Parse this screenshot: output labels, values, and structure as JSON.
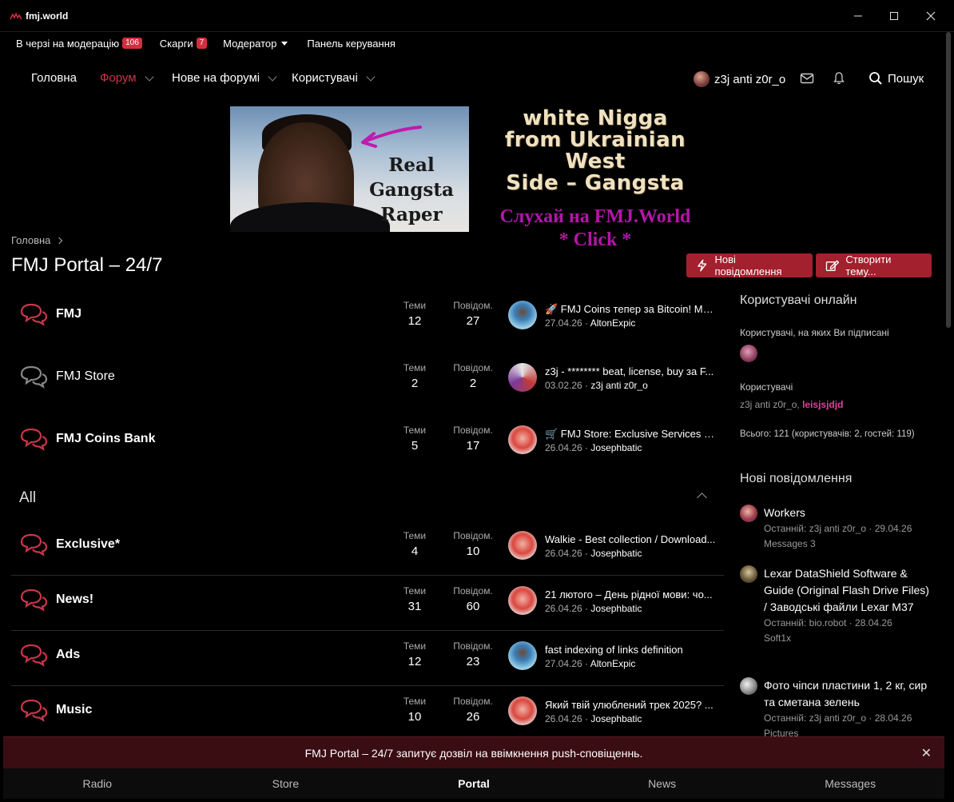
{
  "window": {
    "title": "fmj.world"
  },
  "modbar": {
    "moderation_label": "В черзі на модерацію",
    "moderation_count": "106",
    "reports_label": "Скарги",
    "reports_count": "7",
    "moderator_label": "Модератор",
    "panel_label": "Панель керування"
  },
  "nav": {
    "home": "Головна",
    "forum": "Форум",
    "new": "Нове на форумі",
    "users": "Користувачі",
    "username": "z3j anti z0r_o",
    "search": "Пошук"
  },
  "banner": {
    "left_text": [
      "Real",
      "Gangsta",
      "Raper"
    ],
    "promo_lines": [
      "white Nigga",
      "from Ukrainian West",
      "Side – Gangsta"
    ],
    "listen": "Слухай на FMJ.World",
    "click": "* Click *"
  },
  "breadcrumb": {
    "home": "Головна"
  },
  "page": {
    "title": "FMJ Portal – 24/7",
    "new_posts_btn": "Нові повідомлення",
    "create_topic_btn": "Створити тему..."
  },
  "labels": {
    "topics": "Теми",
    "posts": "Повідом."
  },
  "forums_top": [
    {
      "name": "FMJ",
      "topics": "12",
      "posts": "27",
      "last_title": "🚀 FMJ Coins тепер за Bitcoin! Ма...",
      "last_date": "27.04.26",
      "last_user": "AltonExpic"
    },
    {
      "name": "FMJ Store",
      "topics": "2",
      "posts": "2",
      "last_title": "z3j - ******** beat, license, buy за F...",
      "last_date": "03.02.26",
      "last_user": "z3j anti z0r_o"
    },
    {
      "name": "FMJ Coins Bank",
      "topics": "5",
      "posts": "17",
      "last_title": "🛒 FMJ Store: Exclusive Services & ...",
      "last_date": "26.04.26",
      "last_user": "Josephbatic"
    }
  ],
  "category": {
    "name": "All"
  },
  "forums_all": [
    {
      "name": "Exclusive*",
      "topics": "4",
      "posts": "10",
      "last_title": "Walkie - Best collection / Download...",
      "last_date": "26.04.26",
      "last_user": "Josephbatic"
    },
    {
      "name": "News!",
      "topics": "31",
      "posts": "60",
      "last_title": "21 лютого – День рідної мови: чо...",
      "last_date": "26.04.26",
      "last_user": "Josephbatic"
    },
    {
      "name": "Ads",
      "topics": "12",
      "posts": "23",
      "last_title": "fast indexing of links definition",
      "last_date": "27.04.26",
      "last_user": "AltonExpic"
    },
    {
      "name": "Music",
      "topics": "10",
      "posts": "26",
      "last_title": "Який твій улюблений трек 2025? ...",
      "last_date": "26.04.26",
      "last_user": "Josephbatic"
    }
  ],
  "sidebar": {
    "online_title": "Користувачі онлайн",
    "following_label": "Користувачі, на яких Ви підписані",
    "users_label": "Користувачі",
    "users_list_plain": "z3j anti z0r_o,",
    "users_list_highlight": "leisjsjdjd",
    "total": "Всього: 121 (користувачів: 2, гостей: 119)",
    "new_posts_title": "Нові повідомлення",
    "new_posts": [
      {
        "title": "Workers",
        "meta": "Останній: z3j anti z0r_o · 29.04.26",
        "forum": "Messages 3"
      },
      {
        "title": "Lexar DataShield Software & Guide (Original Flash Drive Files) / Заводські файли Lexar M37",
        "meta": "Останній: bio.robot · 28.04.26",
        "forum": "Soft1x"
      },
      {
        "title": "Фото чіпси пластини 1, 2 кг, сир та сметана зелень",
        "meta": "Останній: z3j anti z0r_o · 28.04.26",
        "forum": "Pictures"
      }
    ]
  },
  "push": {
    "text": "FMJ Portal – 24/7 запитує дозвіл на ввімкнення push-сповіщеннь."
  },
  "tabs": [
    "Radio",
    "Store",
    "Portal",
    "News",
    "Messages"
  ],
  "colors": {
    "accent": "#a3202e",
    "link_active": "#c9364a",
    "highlight_user": "#e0419a",
    "promo_purple": "#b316a8"
  }
}
